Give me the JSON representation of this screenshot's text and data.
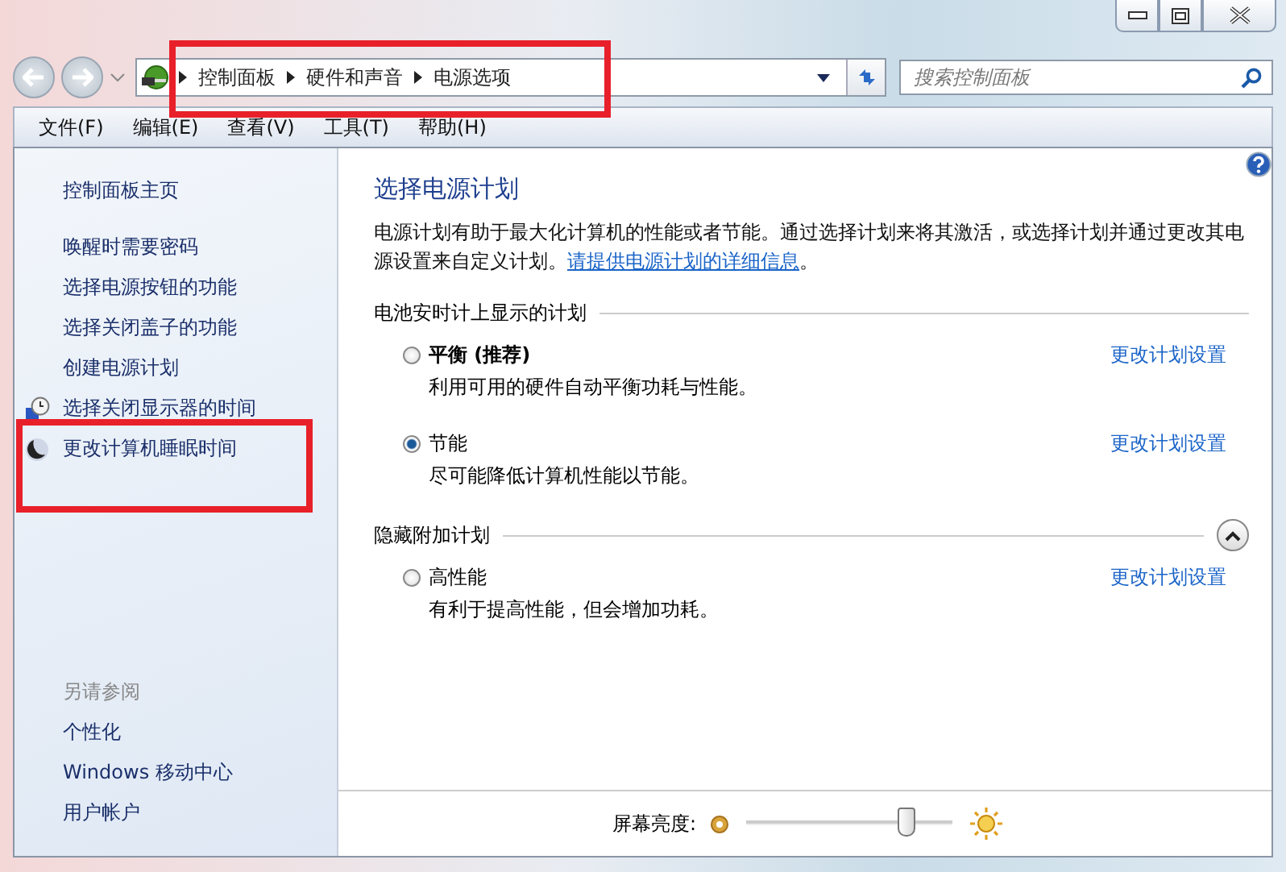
{
  "address_bar": {
    "breadcrumbs": [
      "控制面板",
      "硬件和声音",
      "电源选项"
    ],
    "highlighted": true
  },
  "search": {
    "placeholder": "搜索控制面板"
  },
  "menu": [
    "文件(F)",
    "编辑(E)",
    "查看(V)",
    "工具(T)",
    "帮助(H)"
  ],
  "sidebar": {
    "home": "控制面板主页",
    "tasks": [
      {
        "label": "唤醒时需要密码",
        "kind": "plain",
        "highlighted": false
      },
      {
        "label": "选择电源按钮的功能",
        "kind": "plain",
        "highlighted": false
      },
      {
        "label": "选择关闭盖子的功能",
        "kind": "plain",
        "highlighted": false
      },
      {
        "label": "创建电源计划",
        "kind": "plain",
        "highlighted": false
      },
      {
        "label": "选择关闭显示器的时间",
        "kind": "clock",
        "highlighted": false
      },
      {
        "label": "更改计算机睡眠时间",
        "kind": "moon",
        "highlighted": true
      }
    ],
    "see_also_title": "另请参阅",
    "see_also": [
      "个性化",
      "Windows 移动中心",
      "用户帐户"
    ]
  },
  "content": {
    "title": "选择电源计划",
    "description": "电源计划有助于最大化计算机的性能或者节能。通过选择计划来将其激活，或选择计划并通过更改其电源设置来自定义计划。",
    "link": "请提供电源计划的详细信息",
    "after_link": "。",
    "groups": [
      {
        "heading": "电池安时计上显示的计划",
        "kind": "plain",
        "plans": [
          {
            "name": "平衡 (推荐)",
            "recommended": true,
            "selected": false,
            "description": "利用可用的硬件自动平衡功耗与性能。",
            "link": "更改计划设置"
          },
          {
            "name": "节能",
            "recommended": false,
            "selected": true,
            "description": "尽可能降低计算机性能以节能。",
            "link": "更改计划设置"
          }
        ]
      },
      {
        "heading": "隐藏附加计划",
        "kind": "collapsible",
        "expanded": true,
        "plans": [
          {
            "name": "高性能",
            "recommended": false,
            "selected": false,
            "description": "有利于提高性能，但会增加功耗。",
            "link": "更改计划设置"
          }
        ]
      }
    ]
  },
  "brightness": {
    "label": "屏幕亮度:",
    "level": 0.78
  }
}
